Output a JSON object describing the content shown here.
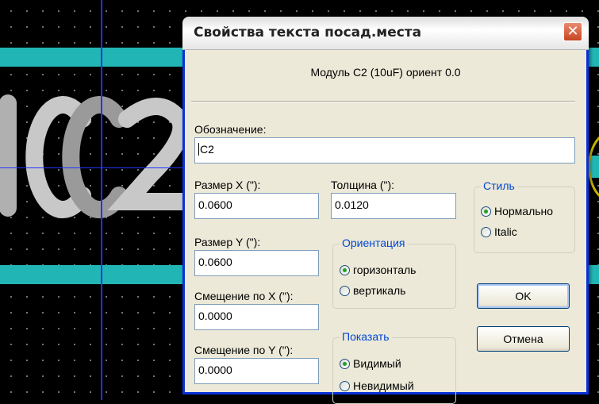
{
  "background": {
    "silkscreen_text": "C2",
    "colors": {
      "canvas": "#000000",
      "track": "#22b5b5",
      "crosshair": "#2233ff",
      "silkscreen": "#c8c8c8",
      "pad_outline": "#c8b400"
    }
  },
  "dialog": {
    "title": "Свойства текста посад.места",
    "close_icon": "close-icon",
    "module_info": "Модуль C2 (10uF) ориент 0.0",
    "reference": {
      "label": "Обозначение:",
      "value": "C2"
    },
    "size_x": {
      "label": "Размер X (\"):",
      "value": "0.0600"
    },
    "thickness": {
      "label": "Толщина (\"):",
      "value": "0.0120"
    },
    "size_y": {
      "label": "Размер Y (\"):",
      "value": "0.0600"
    },
    "offset_x": {
      "label": "Смещение по X (\"):",
      "value": "0.0000"
    },
    "offset_y": {
      "label": "Смещение по Y (\"):",
      "value": "0.0000"
    },
    "style": {
      "legend": "Стиль",
      "options": [
        "Нормально",
        "Italic"
      ],
      "selected": "Нормально"
    },
    "orientation": {
      "legend": "Ориентация",
      "options": [
        "горизонталь",
        "вертикаль"
      ],
      "selected": "горизонталь"
    },
    "show": {
      "legend": "Показать",
      "options": [
        "Видимый",
        "Невидимый"
      ],
      "selected": "Видимый"
    },
    "ok_label": "OK",
    "cancel_label": "Отмена",
    "accent_color": "#0046d5"
  }
}
